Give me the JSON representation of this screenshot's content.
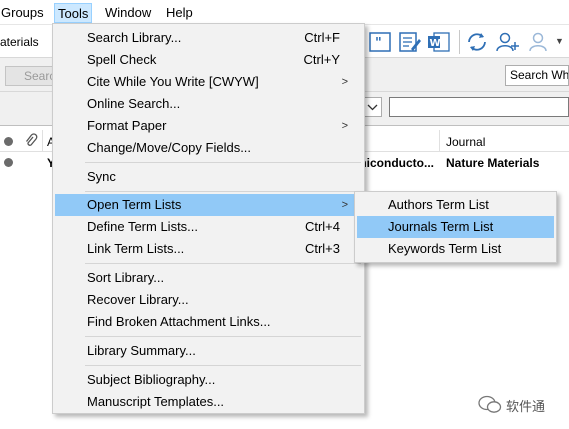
{
  "menubar": {
    "items": [
      "Groups",
      "Tools",
      "Window",
      "Help"
    ],
    "active": "Tools"
  },
  "toolbar": {
    "partial_label": "aterials"
  },
  "search": {
    "button_label": "Search",
    "who_box_text": "Search Who"
  },
  "list": {
    "header_partial": "A",
    "journal_header": "Journal",
    "row1_partial_letter": "Y",
    "row1_title_fragment": "miconducto...",
    "row1_journal": "Nature Materials"
  },
  "menu": {
    "items": [
      {
        "label": "Search Library...",
        "shortcut": "Ctrl+F"
      },
      {
        "label": "Spell Check",
        "shortcut": "Ctrl+Y"
      },
      {
        "label": "Cite While You Write [CWYW]",
        "shortcut": "",
        "submenu": true
      },
      {
        "label": "Online Search...",
        "shortcut": ""
      },
      {
        "label": "Format Paper",
        "shortcut": "",
        "submenu": true
      },
      {
        "label": "Change/Move/Copy Fields...",
        "shortcut": ""
      },
      {
        "label": "Sync",
        "shortcut": ""
      },
      {
        "label": "Open Term Lists",
        "shortcut": "",
        "submenu": true,
        "highlighted": true
      },
      {
        "label": "Define Term Lists...",
        "shortcut": "Ctrl+4"
      },
      {
        "label": "Link Term Lists...",
        "shortcut": "Ctrl+3"
      },
      {
        "label": "Sort Library...",
        "shortcut": ""
      },
      {
        "label": "Recover Library...",
        "shortcut": ""
      },
      {
        "label": "Find Broken Attachment Links...",
        "shortcut": ""
      },
      {
        "label": "Library Summary...",
        "shortcut": ""
      },
      {
        "label": "Subject Bibliography...",
        "shortcut": ""
      },
      {
        "label": "Manuscript Templates...",
        "shortcut": ""
      }
    ]
  },
  "submenu": {
    "items": [
      {
        "label": "Authors Term List"
      },
      {
        "label": "Journals Term List",
        "highlighted": true
      },
      {
        "label": "Keywords Term List"
      }
    ]
  },
  "watermark": {
    "text": "软件通"
  },
  "colors": {
    "menu_bg": "#f2f2f2",
    "highlight": "#91c9f7",
    "menubar_active": "#cce8ff",
    "icon_blue": "#2f6fb5"
  }
}
